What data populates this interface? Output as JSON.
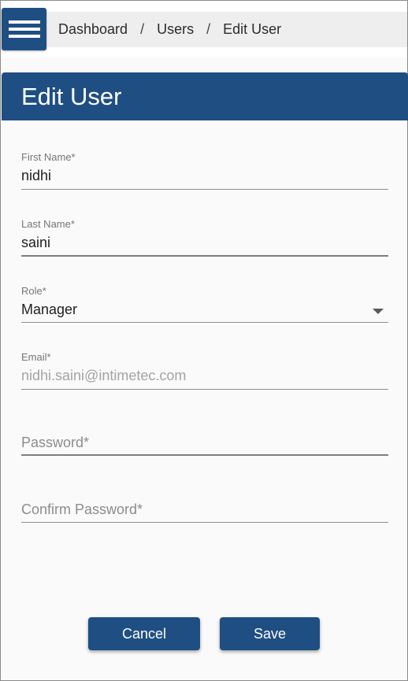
{
  "breadcrumb": {
    "items": [
      "Dashboard",
      "Users",
      "Edit User"
    ],
    "separator": "/"
  },
  "header": {
    "title": "Edit User"
  },
  "form": {
    "first_name": {
      "label": "First Name*",
      "value": "nidhi"
    },
    "last_name": {
      "label": "Last Name*",
      "value": "saini"
    },
    "role": {
      "label": "Role*",
      "value": "Manager"
    },
    "email": {
      "label": "Email*",
      "value": "nidhi.saini@intimetec.com"
    },
    "password": {
      "placeholder": "Password*"
    },
    "confirm_password": {
      "placeholder": "Confirm Password*"
    }
  },
  "actions": {
    "cancel_label": "Cancel",
    "save_label": "Save"
  },
  "colors": {
    "primary": "#1f4f82",
    "background": "#fafafa",
    "breadcrumb_bg": "#eeeeee"
  },
  "icons": {
    "menu": "hamburger-menu-icon",
    "dropdown": "caret-down-icon"
  }
}
